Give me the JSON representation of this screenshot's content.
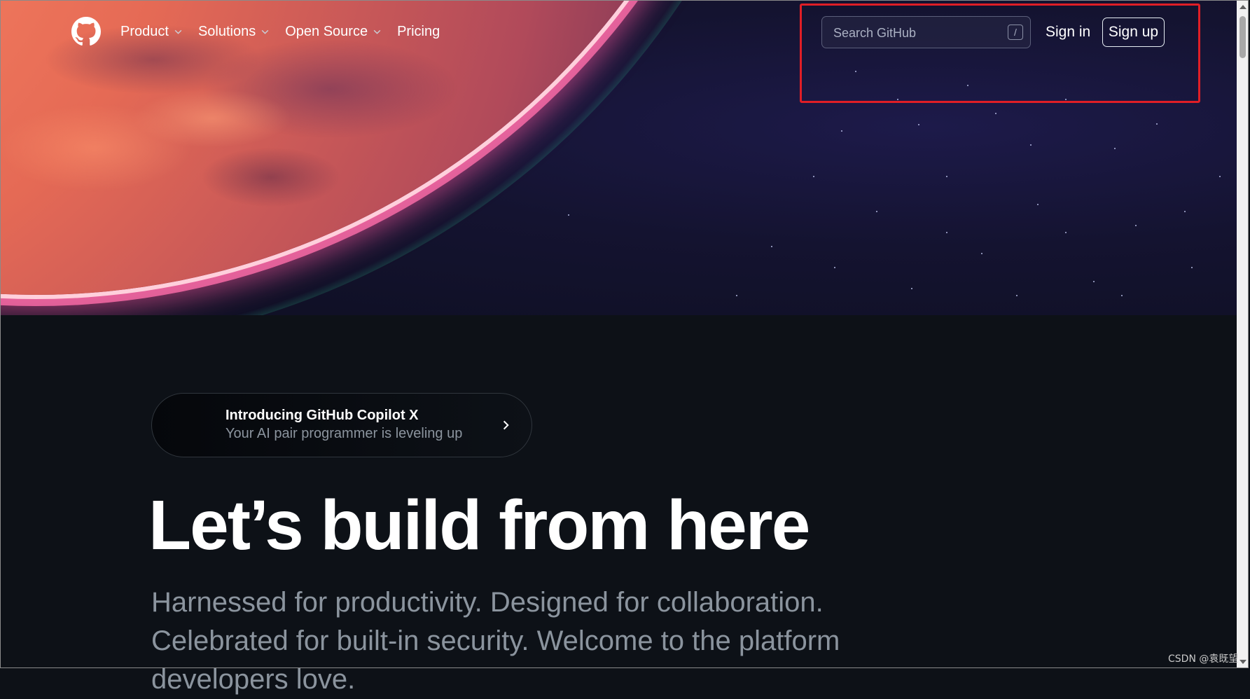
{
  "header": {
    "logo_icon": "github-mark-icon",
    "nav": [
      {
        "label": "Product",
        "has_dropdown": true
      },
      {
        "label": "Solutions",
        "has_dropdown": true
      },
      {
        "label": "Open Source",
        "has_dropdown": true
      },
      {
        "label": "Pricing",
        "has_dropdown": false
      }
    ],
    "search": {
      "placeholder": "Search GitHub",
      "shortcut": "/"
    },
    "sign_in": "Sign in",
    "sign_up": "Sign up"
  },
  "announcement": {
    "title": "Introducing GitHub Copilot X",
    "subtitle": "Your AI pair programmer is leveling up"
  },
  "hero": {
    "headline": "Let’s build from here",
    "subtext": "Harnessed for productivity. Designed for collaboration. Celebrated for built-in security. Welcome to the platform developers love."
  },
  "watermark": "CSDN @袁既望",
  "colors": {
    "background": "#0d1117",
    "highlight_box": "#e01e26",
    "muted_text": "#8b949e"
  }
}
